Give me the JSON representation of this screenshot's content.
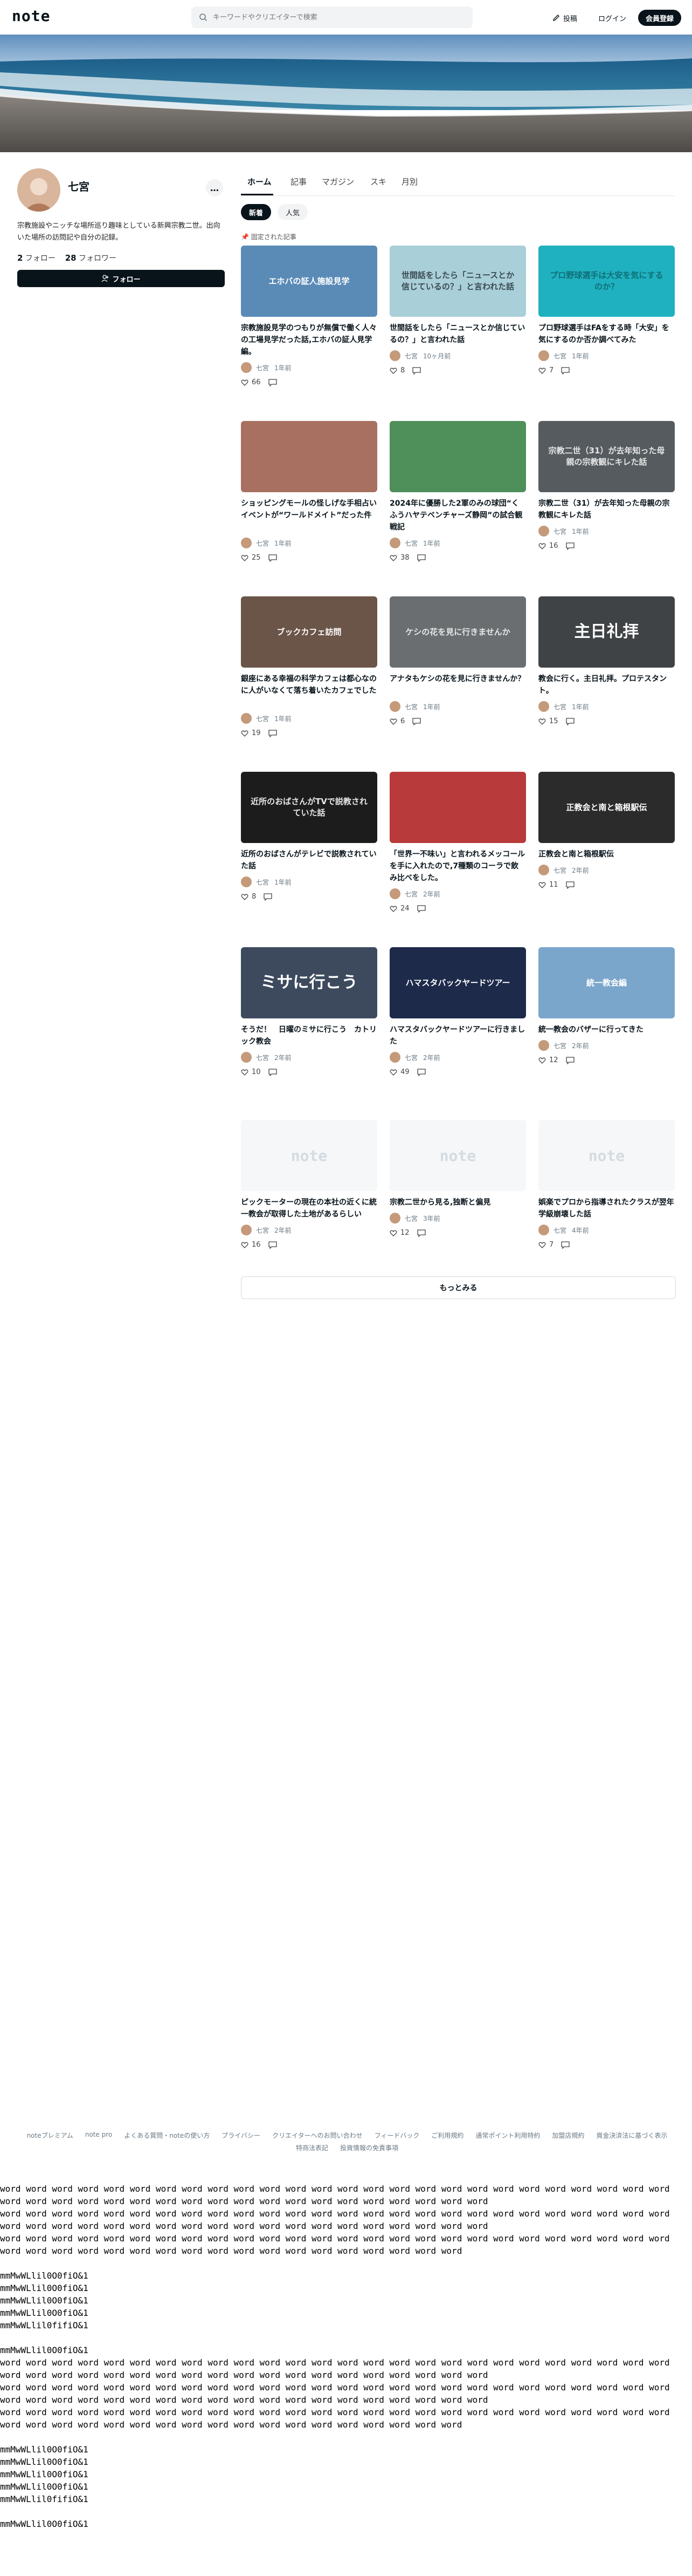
{
  "header": {
    "logo": "note",
    "search_placeholder": "キーワードやクリエイターで検索",
    "post_label": "投稿",
    "login_label": "ログイン",
    "signup_label": "会員登録"
  },
  "profile": {
    "name": "七宮",
    "bio": "宗教施設やニッチな場所巡り趣味としている新興宗教二世。出向いた場所の訪問記や自分の記録。",
    "follow_count": "2",
    "follow_label": "フォロー",
    "follower_count": "28",
    "follower_label": "フォロワー",
    "follow_button": "フォロー",
    "more_label": "…"
  },
  "tabs": [
    "ホーム",
    "記事",
    "マガジン",
    "スキ",
    "月別"
  ],
  "chips": {
    "new": "新着",
    "popular": "人気"
  },
  "pinned_label": "固定された記事",
  "articles": [
    {
      "title": "宗教施設見学のつもりが無償で働く人々の工場見学だった話,エホバの証人見学編。",
      "author": "七宮",
      "time": "1年前",
      "likes": "66",
      "thumb": {
        "type": "photo",
        "label": "エホバの証人施設見学",
        "bg": "#5a8bb7"
      }
    },
    {
      "title": "世間話をしたら「ニュースとか信じているの？」と言われた話",
      "author": "七宮",
      "time": "10ヶ月前",
      "likes": "8",
      "thumb": {
        "type": "text",
        "label": "世間話をしたら「ニュースとか信じているの？」と言われた話",
        "bg": "#a9cfd8",
        "fg": "#3a4a52"
      }
    },
    {
      "title": "プロ野球選手はFAをする時「大安」を気にするのか否か調べてみた",
      "author": "七宮",
      "time": "1年前",
      "likes": "7",
      "thumb": {
        "type": "text",
        "label": "プロ野球選手は大安を気にするのか？",
        "bg": "#1fb1bf",
        "fg": "#0f6f78"
      }
    },
    {
      "title": "ショッピングモールの怪しげな手相占いイベントが“ワールドメイト”だった件",
      "author": "七宮",
      "time": "1年前",
      "likes": "25",
      "thumb": {
        "type": "photo",
        "label": "",
        "bg": "#a87060"
      }
    },
    {
      "title": "2024年に優勝した2軍のみの球団“くふうハヤテベンチャーズ静岡”の試合観戦記",
      "author": "七宮",
      "time": "1年前",
      "likes": "38",
      "thumb": {
        "type": "photo",
        "label": "",
        "bg": "#4f8f5a"
      }
    },
    {
      "title": "宗教二世（31）が去年知った母親の宗教観にキレた話",
      "author": "七宮",
      "time": "1年前",
      "likes": "16",
      "thumb": {
        "type": "text",
        "label": "宗教二世（31）が去年知った母親の宗教観にキレた話",
        "bg": "#555b5f",
        "fg": "#e6e6e6"
      }
    },
    {
      "title": "銀座にある幸福の科学カフェは都心なのに人がいなくて落ち着いたカフェでした",
      "author": "七宮",
      "time": "1年前",
      "likes": "19",
      "thumb": {
        "type": "photo",
        "label": "ブックカフェ訪問",
        "bg": "#6b5548"
      }
    },
    {
      "title": "アナタもケシの花を見に行きませんか？",
      "author": "七宮",
      "time": "1年前",
      "likes": "6",
      "thumb": {
        "type": "text",
        "label": "ケシの花を見に行きませんか",
        "bg": "#6b6e70",
        "fg": "#e6e6e6"
      }
    },
    {
      "title": "教会に行く。主日礼拝。プロテスタント。",
      "author": "七宮",
      "time": "1年前",
      "likes": "15",
      "thumb": {
        "type": "text",
        "label": "主日礼拝",
        "bg": "#3f4346",
        "fg": "#ffffff"
      }
    },
    {
      "title": "近所のおばさんがテレビで説教されていた話",
      "author": "七宮",
      "time": "1年前",
      "likes": "8",
      "thumb": {
        "type": "text",
        "label": "近所のおばさんがTVで説教されていた話",
        "bg": "#1c1c1c",
        "fg": "#e6e6e6"
      }
    },
    {
      "title": "「世界一不味い」と言われるメッコールを手に入れたので,7種類のコーラで飲み比べをした。",
      "author": "七宮",
      "time": "2年前",
      "likes": "24",
      "thumb": {
        "type": "photo",
        "label": "",
        "bg": "#b83a3a"
      }
    },
    {
      "title": "正教会と南と箱根駅伝",
      "author": "七宮",
      "time": "2年前",
      "likes": "11",
      "thumb": {
        "type": "text",
        "label": "正教会と南と箱根駅伝",
        "bg": "#2b2b2b",
        "fg": "#ffffff"
      }
    },
    {
      "title": "そうだ！　日曜のミサに行こう　カトリック教会",
      "author": "七宮",
      "time": "2年前",
      "likes": "10",
      "thumb": {
        "type": "text",
        "label": "ミサに行こう",
        "bg": "#3d4a5e",
        "fg": "#ffffff"
      }
    },
    {
      "title": "ハマスタバックヤードツアーに行きました",
      "author": "七宮",
      "time": "2年前",
      "likes": "49",
      "thumb": {
        "type": "photo",
        "label": "ハマスタバックヤードツアー",
        "bg": "#1d2a4a"
      }
    },
    {
      "title": "統一教会のバザーに行ってきた",
      "author": "七宮",
      "time": "2年前",
      "likes": "12",
      "thumb": {
        "type": "photo",
        "label": "統一教会編",
        "bg": "#7aa6cc"
      }
    },
    {
      "title": "ピックモーターの現在の本社の近くに統一教会が取得した土地があるらしい",
      "author": "七宮",
      "time": "2年前",
      "likes": "16",
      "thumb": {
        "type": "placeholder",
        "label": "note",
        "bg": "#f5f7f8",
        "fg": "#d5dbe0"
      }
    },
    {
      "title": "宗教二世から見る,独断と偏見",
      "author": "七宮",
      "time": "3年前",
      "likes": "12",
      "thumb": {
        "type": "placeholder",
        "label": "note",
        "bg": "#f5f7f8",
        "fg": "#d5dbe0"
      }
    },
    {
      "title": "娯楽でプロから指導されたクラスが翌年学級崩壊した話",
      "author": "七宮",
      "time": "4年前",
      "likes": "7",
      "thumb": {
        "type": "placeholder",
        "label": "note",
        "bg": "#f5f7f8",
        "fg": "#d5dbe0"
      }
    }
  ],
  "more_label": "もっとみる",
  "footer_links": [
    "noteプレミアム",
    "note pro",
    "よくある質問・noteの使い方",
    "プライバシー",
    "クリエイターへのお問い合わせ",
    "フィードバック",
    "ご利用規約",
    "通常ポイント利用特約",
    "加盟店規約",
    "資金決済法に基づく表示",
    "特商法表記",
    "投資情報の免責事項"
  ],
  "filler": {
    "word_line": "word word word word word word word word word word word word word word word word word word word word word word word word word word word word word word word word word word word word word word word word word word word word word",
    "word_line_short": "word word word word word word word word word word word word word word word word word word word word word word word word word word word word word word word word word word word word word word word word word word word word",
    "glyph_lines": [
      "mmMwWLlil0O0fiO&1",
      "mmMwWLlil0O0fiO&1",
      "mmMwWLlil0O0fiO&1",
      "mmMwWLlil0O0fiO&1",
      "mmMwWLlil0fifiO&1"
    ],
    "glyph_line_single": "mmMwWLlil0O0fiO&1"
  }
}
